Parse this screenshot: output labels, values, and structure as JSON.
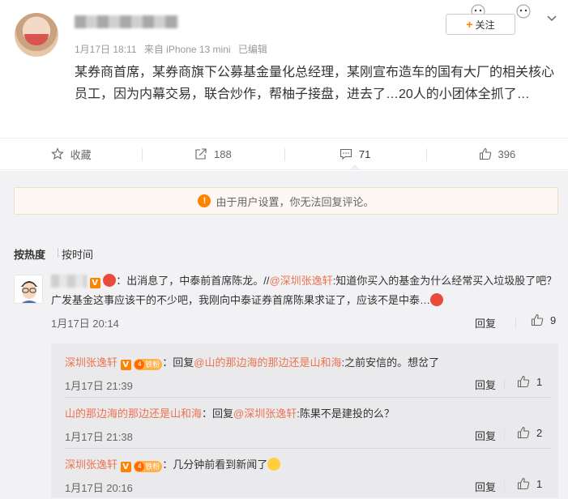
{
  "post": {
    "meta": {
      "date": "1月17日 18:11",
      "source": "来自 iPhone 13 mini",
      "edited": "已编辑"
    },
    "follow_label": "关注",
    "text": "某券商首席，某券商旗下公募基金量化总经理，某刚宣布造车的国有大厂的相关核心员工，因为内幕交易，联合炒作，帮柚子接盘，进去了…20人的小团体全抓了…"
  },
  "actions": {
    "favorite": "收藏",
    "repost_count": "188",
    "comment_count": "71",
    "like_count": "396"
  },
  "notice": "由于用户设置，你无法回复评论。",
  "sort": {
    "hot": "按热度",
    "time": "按时间"
  },
  "comment": {
    "text_prefix": "：出消息了，中泰前首席陈龙。//",
    "mention": "@深圳张逸轩",
    "text_suffix": ":知道你买入的基金为什么经常买入垃圾股了吧？广发基金这事应该干的不少吧，我刚向中泰证券首席陈果求证了，应该不是中泰…",
    "time": "1月17日 20:14",
    "reply": "回复",
    "likes": "9"
  },
  "replies": [
    {
      "author": "深圳张逸轩",
      "fans_label": "铁粉",
      "pre": "：回复",
      "mention": "@山的那边海的那边还是山和海",
      "post": ":之前安信的。想岔了",
      "time": "1月17日 21:39",
      "reply": "回复",
      "likes": "1"
    },
    {
      "author": "山的那边海的那边还是山和海",
      "pre": "：回复",
      "mention": "@深圳张逸轩",
      "post": ":陈果不是建投的么？",
      "time": "1月17日 21:38",
      "reply": "回复",
      "likes": "2"
    },
    {
      "author": "深圳张逸轩",
      "fans_label": "铁粉",
      "post": "：几分钟前看到新闻了",
      "time": "1月17日 20:16",
      "reply": "回复",
      "likes": "1"
    }
  ],
  "colors": {
    "accent": "#ff8200",
    "link": "#eb7350",
    "comment_bg": "#f2f2f5"
  }
}
